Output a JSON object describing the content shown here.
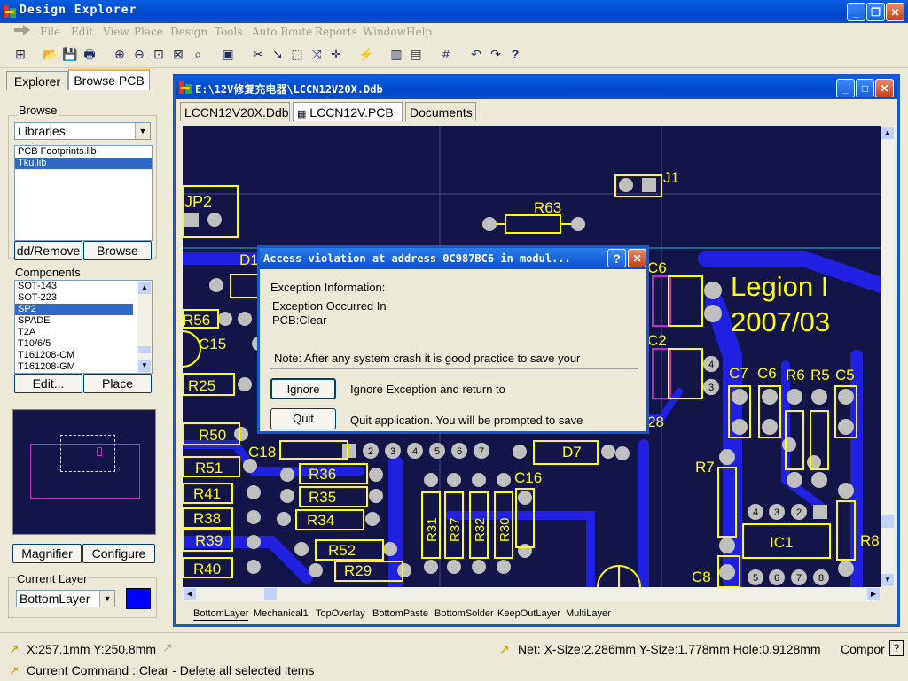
{
  "app": {
    "title": "Design Explorer"
  },
  "menu": {
    "items": [
      "File",
      "Edit",
      "View",
      "Place",
      "Design",
      "Tools",
      "Auto Route",
      "Reports",
      "Window",
      "Help"
    ]
  },
  "left_panel": {
    "tabs": [
      "Explorer",
      "Browse PCB"
    ],
    "browse_label": "Browse",
    "browse_select": "Libraries",
    "libraries": [
      "PCB Footprints.lib",
      "Tku.lib"
    ],
    "selected_library": "Tku.lib",
    "add_remove_label": "dd/Remove",
    "browse_button": "Browse",
    "components_label": "Components",
    "components": [
      "SOT-143",
      "SOT-223",
      "SP2",
      "SPADE",
      "T2A",
      "T10/6/5",
      "T161208-CM",
      "T161208-GM"
    ],
    "selected_component": "SP2",
    "edit_button": "Edit...",
    "place_button": "Place",
    "magnifier_button": "Magnifier",
    "configure_button": "Configure",
    "current_layer_label": "Current Layer",
    "current_layer": "BottomLayer",
    "layer_color": "#0000ff"
  },
  "document": {
    "title": "E:\\12V修复充电器\\LCCN12V20X.Ddb",
    "tabs": [
      "LCCN12V20X.Ddb",
      "LCCN12V.PCB",
      "Documents"
    ],
    "active_tab": "LCCN12V.PCB",
    "layer_tabs": [
      "BottomLayer",
      "Mechanical1",
      "TopOverlay",
      "BottomPaste",
      "BottomSolder",
      "KeepOutLayer",
      "MultiLayer"
    ]
  },
  "pcb": {
    "labels": [
      "J1",
      "JP2",
      "R63",
      "D1",
      "R56",
      "C15",
      "R25",
      "R50",
      "C18",
      "R51",
      "R41",
      "R38",
      "R39",
      "R40",
      "R36",
      "R35",
      "R34",
      "R52",
      "R29",
      "R31",
      "R37",
      "R32",
      "R30",
      "C16",
      "D7",
      "R7",
      "C7",
      "C6",
      "R6",
      "R5",
      "C5",
      "IC1",
      "R8",
      "C8",
      "C2",
      "C6"
    ],
    "pin_numbers": [
      "2",
      "3",
      "4",
      "5",
      "6",
      "7"
    ],
    "ic_pins_top": [
      "4",
      "3",
      "2"
    ],
    "ic_pins_bottom": [
      "5",
      "6",
      "7",
      "8"
    ],
    "side_pins": [
      "4",
      "3"
    ],
    "overlay_text_1": "Legion I",
    "overlay_text_2": "2007/03",
    "partial_label": "28",
    "colors": {
      "board": "#131447",
      "overlay": "#ffff00",
      "trace": "#2020e0",
      "pad": "#c0c0c0"
    }
  },
  "dialog": {
    "title": "Access violation at address 0C987BC6 in modul...",
    "help_btn": "?",
    "info_label": "Exception Information:",
    "occurred_in": "Exception Occurred In",
    "context": "PCB:Clear",
    "note": "Note: After any system crash it is good practice to save your",
    "ignore_button": "Ignore",
    "ignore_desc": "Ignore Exception and return to",
    "quit_button": "Quit",
    "quit_desc": "Quit application. You will be prompted to save"
  },
  "status": {
    "coords": "X:257.1mm Y:250.8mm",
    "net_info": "Net: X-Size:2.286mm Y-Size:1.778mm Hole:0.9128mm",
    "component_cut": "Compor",
    "current_command": "Current Command : Clear - Delete all selected items"
  }
}
